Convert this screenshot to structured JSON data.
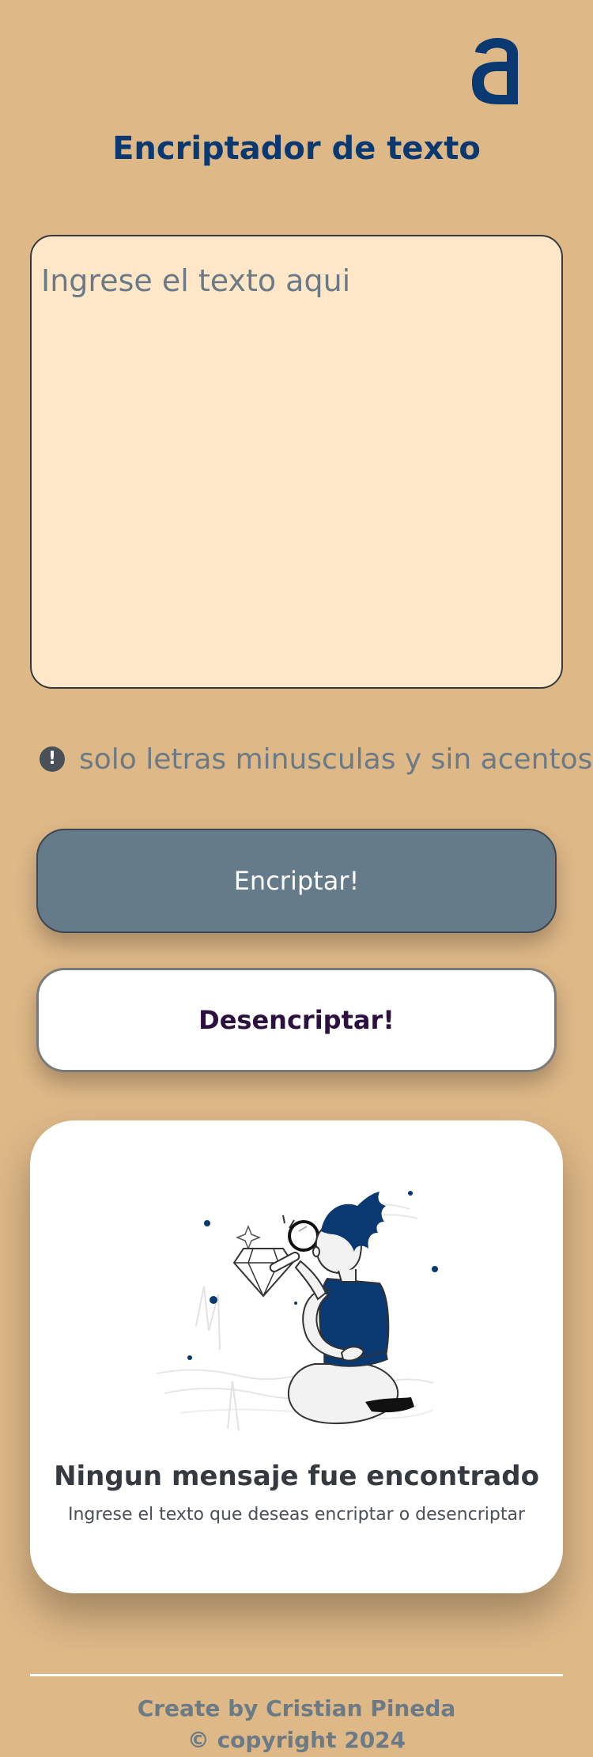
{
  "header": {
    "logo_icon": "alura-a-logo-icon",
    "title": "Encriptador de texto"
  },
  "input": {
    "placeholder": "Ingrese el texto aqui"
  },
  "hint": {
    "icon": "exclamation-circle-icon",
    "text": "solo letras minusculas y sin acentos"
  },
  "buttons": {
    "encrypt_label": "Encriptar!",
    "decrypt_label": "Desencriptar!"
  },
  "output": {
    "illustration": "person-with-magnifying-glass-illustration",
    "title": "Ningun mensaje fue encontrado",
    "subtitle": "Ingrese el texto que deseas encriptar o desencriptar"
  },
  "footer": {
    "author": "Create by Cristian Pineda",
    "copyright": "© copyright 2024"
  },
  "colors": {
    "background": "#deb887",
    "brand_blue": "#0a3871",
    "textarea_bg": "#ffe7c8",
    "encrypt_button": "#667b8a",
    "decrypt_text": "#2b1040",
    "muted_text": "#6b7a87"
  }
}
